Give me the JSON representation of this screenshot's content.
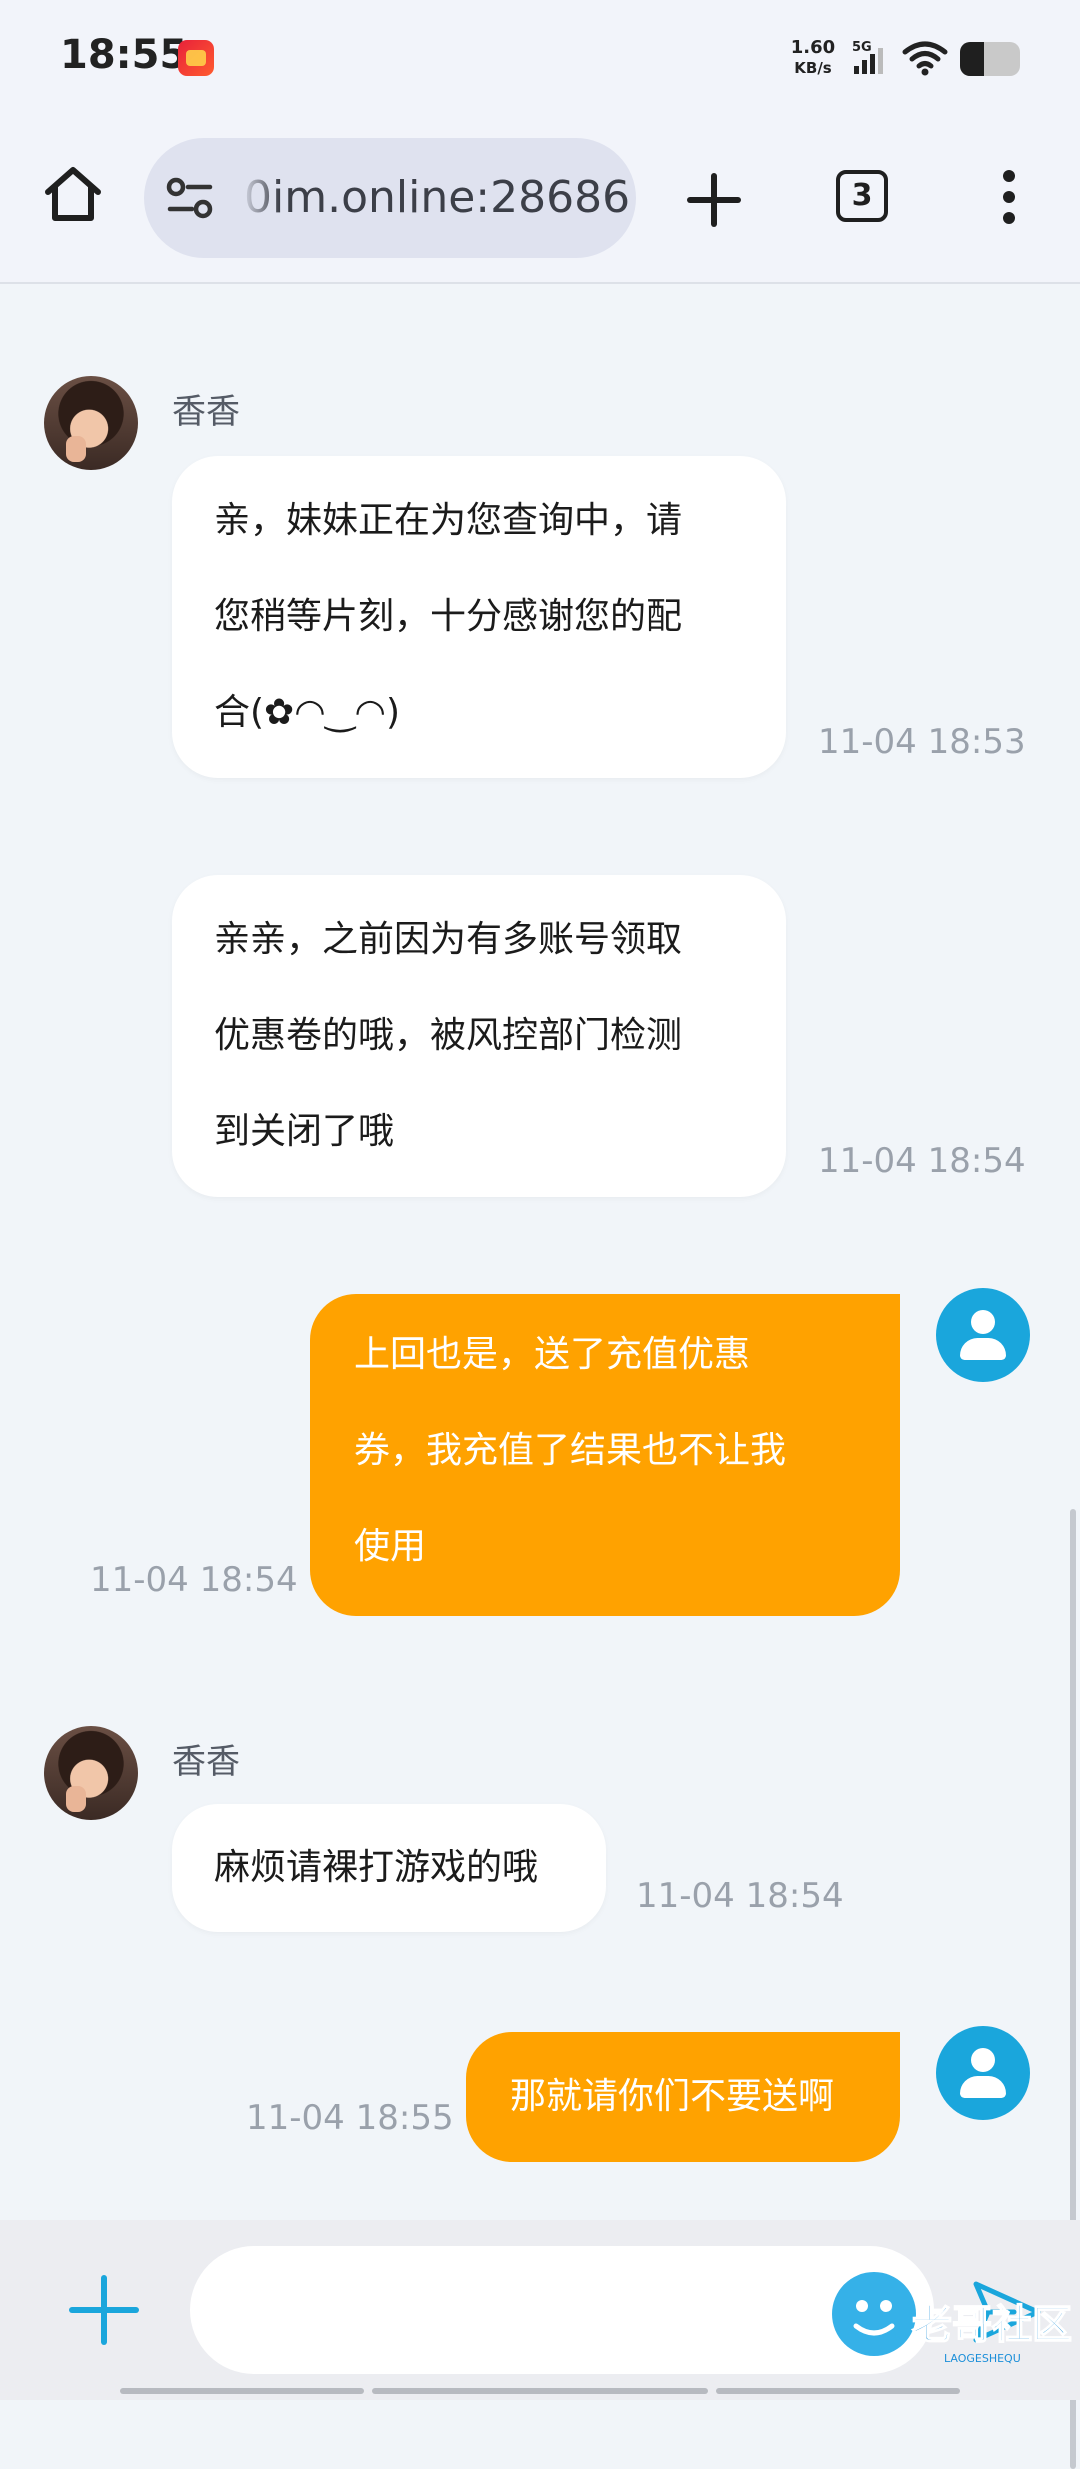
{
  "status_bar": {
    "time": "18:55",
    "net_speed_value": "1.60",
    "net_speed_unit": "KB/s",
    "network_type": "5G",
    "battery_level": 0.4
  },
  "browser": {
    "url": "0im.online:28686",
    "tab_count": "3"
  },
  "messages": [
    {
      "direction": "in",
      "sender": "香香",
      "lines": [
        "亲，妹妹正在为您查询中，请",
        "您稍等片刻，十分感谢您的配",
        "合(✿◠‿◠)"
      ],
      "time": "11-04 18:53"
    },
    {
      "direction": "in",
      "lines": [
        "亲亲，之前因为有多账号领取",
        "优惠卷的哦，被风控部门检测",
        "到关闭了哦"
      ],
      "time": "11-04 18:54"
    },
    {
      "direction": "out",
      "lines": [
        "上回也是，送了充值优惠",
        "券，我充值了结果也不让我",
        "使用"
      ],
      "time": "11-04 18:54"
    },
    {
      "direction": "in",
      "sender": "香香",
      "lines": [
        "麻烦请裸打游戏的哦"
      ],
      "time": "11-04 18:54"
    },
    {
      "direction": "out",
      "lines": [
        "那就请你们不要送啊"
      ],
      "time": "11-04 18:55"
    }
  ],
  "input": {
    "placeholder": ""
  },
  "watermark": {
    "text": "老哥社区",
    "subtext": "LAOGESHEQU"
  },
  "colors": {
    "outgoing_bubble": "#ffa200",
    "user_avatar": "#1aa6dc",
    "plus_icon": "#1aa6dc"
  },
  "icons": [
    "home-icon",
    "site-settings-icon",
    "new-tab-icon",
    "tab-switcher-icon",
    "more-menu-icon",
    "plus-icon",
    "send-icon"
  ]
}
